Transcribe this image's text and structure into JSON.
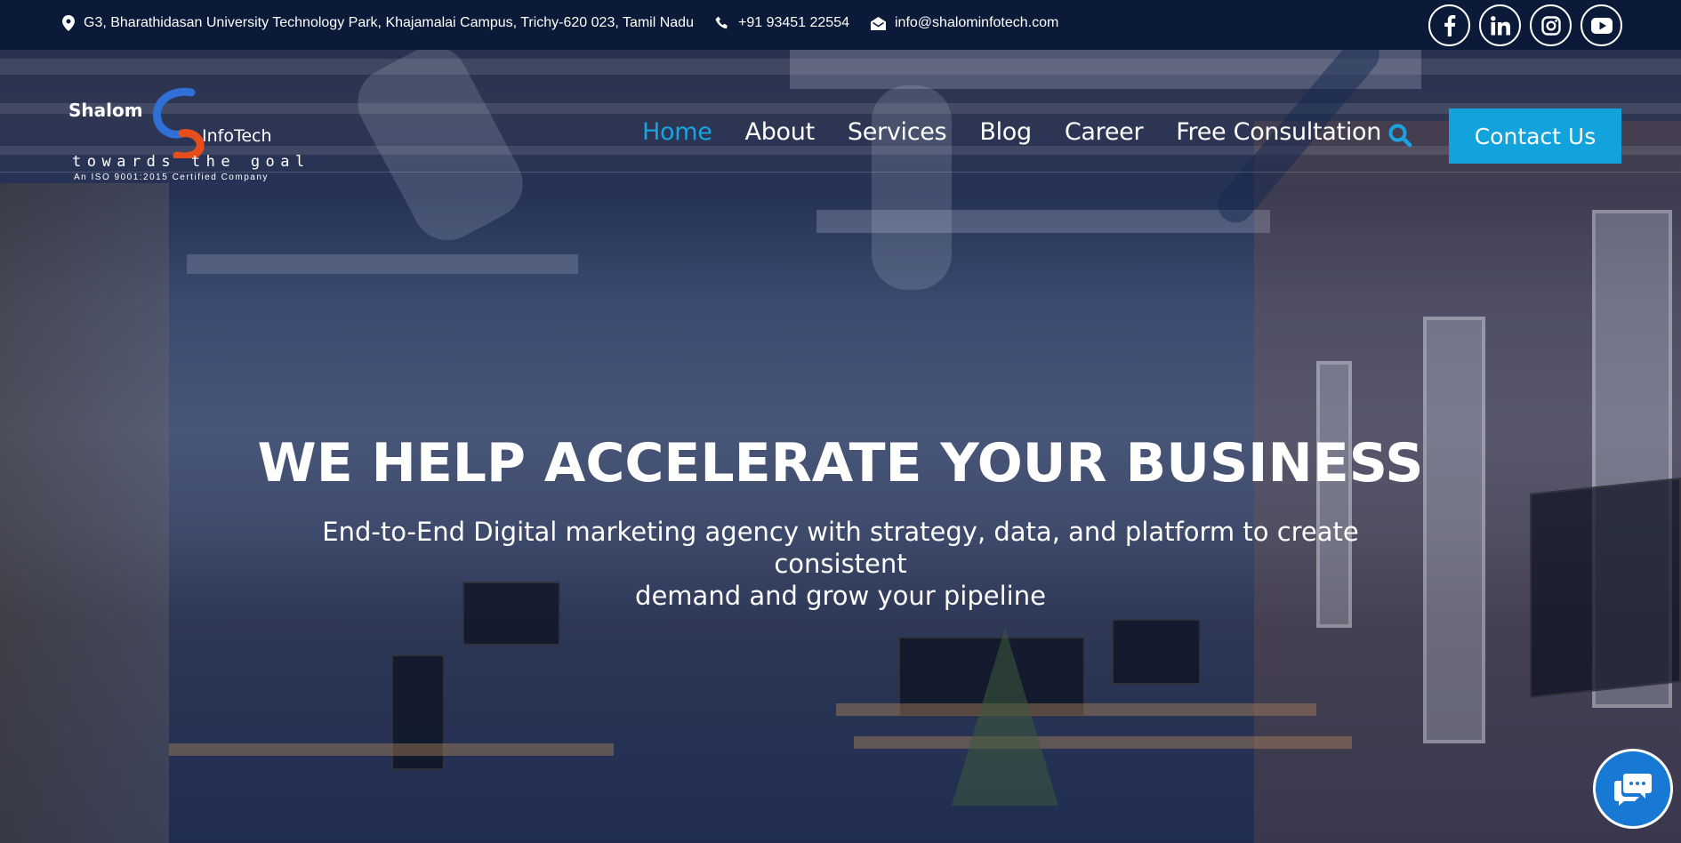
{
  "topbar": {
    "address": "G3, Bharathidasan University Technology Park, Khajamalai Campus, Trichy-620 023, Tamil Nadu",
    "phone": "+91 93451 22554",
    "email": "info@shalominfotech.com",
    "social": [
      "facebook-icon",
      "linkedin-icon",
      "instagram-icon",
      "youtube-icon"
    ]
  },
  "logo": {
    "brand_left": "Shalom",
    "brand_right": "InfoTech",
    "tagline": "towards the goal",
    "certification": "An ISO 9001:2015 Certified Company"
  },
  "nav": {
    "items": [
      {
        "label": "Home",
        "active": true
      },
      {
        "label": "About",
        "active": false
      },
      {
        "label": "Services",
        "active": false
      },
      {
        "label": "Blog",
        "active": false
      },
      {
        "label": "Career",
        "active": false
      },
      {
        "label": "Free Consultation",
        "active": false
      }
    ],
    "search_icon": "search-icon",
    "contact_label": "Contact Us"
  },
  "hero": {
    "title": "WE HELP ACCELERATE YOUR BUSINESS",
    "subtitle_line1": "End-to-End Digital marketing agency with strategy, data, and platform to create consistent",
    "subtitle_line2": "demand and grow your pipeline"
  },
  "chat": {
    "icon": "chat-icon"
  },
  "colors": {
    "topbar": "#0b1a38",
    "accent": "#12a3dd",
    "active_nav": "#1aa3e0",
    "chat": "#1779d3"
  }
}
